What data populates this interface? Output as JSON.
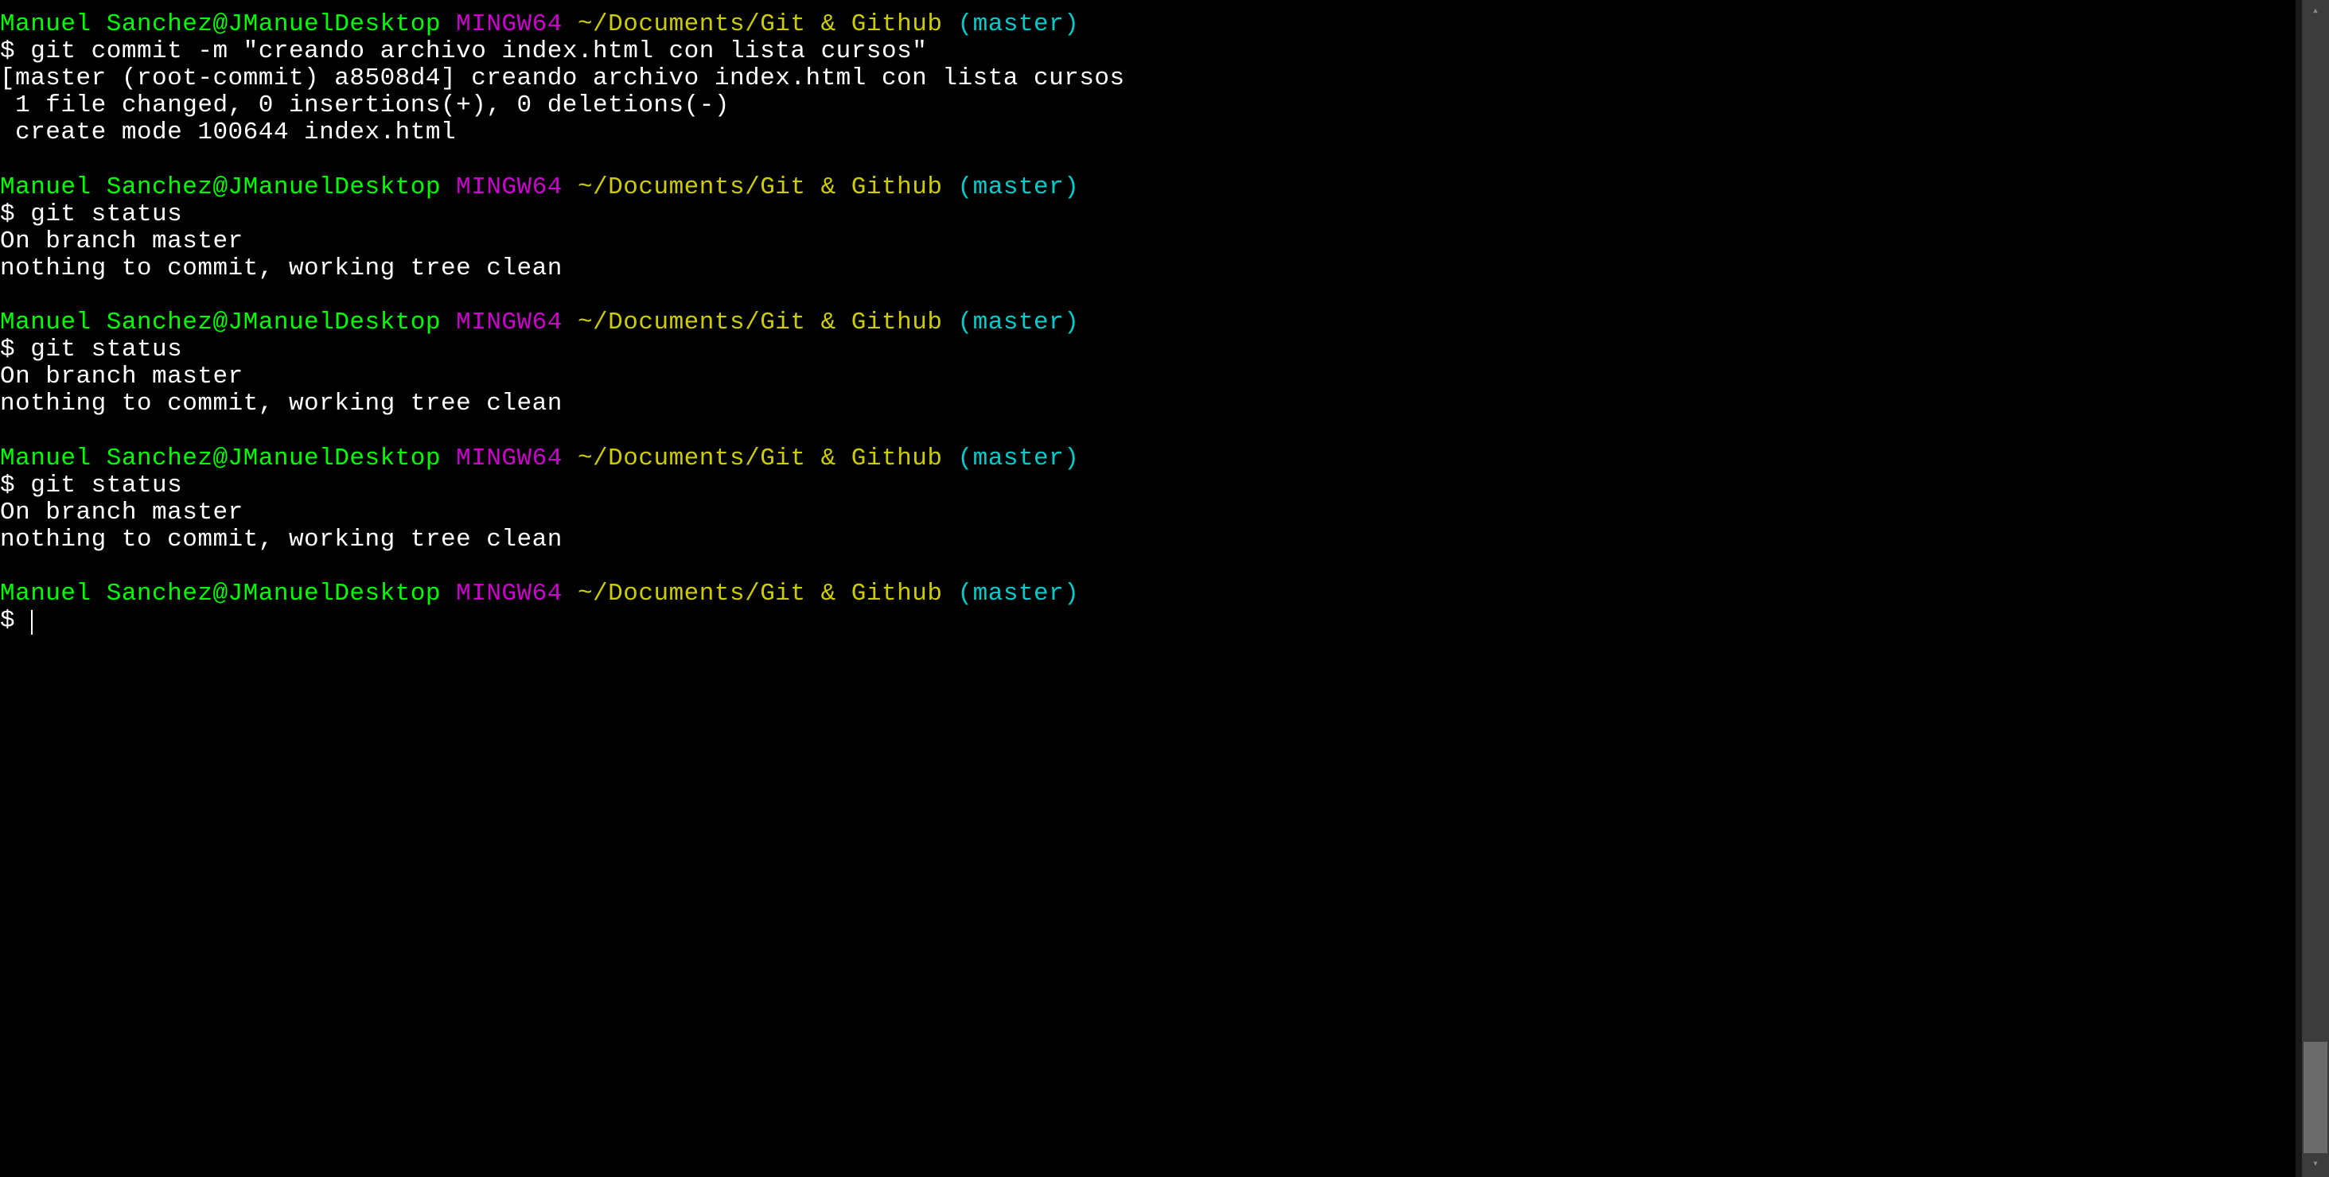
{
  "prompt": {
    "user_host": "Manuel Sanchez@JManuelDesktop",
    "env": "MINGW64",
    "path": "~/Documents/Git & Github",
    "branch": "(master)",
    "symbol": "$"
  },
  "blocks": [
    {
      "command": "git commit -m \"creando archivo index.html con lista cursos\"",
      "output": [
        "[master (root-commit) a8508d4] creando archivo index.html con lista cursos",
        " 1 file changed, 0 insertions(+), 0 deletions(-)",
        " create mode 100644 index.html"
      ]
    },
    {
      "command": "git status",
      "output": [
        "On branch master",
        "nothing to commit, working tree clean"
      ]
    },
    {
      "command": "git status",
      "output": [
        "On branch master",
        "nothing to commit, working tree clean"
      ]
    },
    {
      "command": "git status",
      "output": [
        "On branch master",
        "nothing to commit, working tree clean"
      ]
    }
  ],
  "final_prompt": true,
  "colors": {
    "green": "#00ff00",
    "purple": "#cc00cc",
    "yellow": "#cccc00",
    "cyan": "#00cccc",
    "white": "#ffffff",
    "bg": "#000000"
  }
}
